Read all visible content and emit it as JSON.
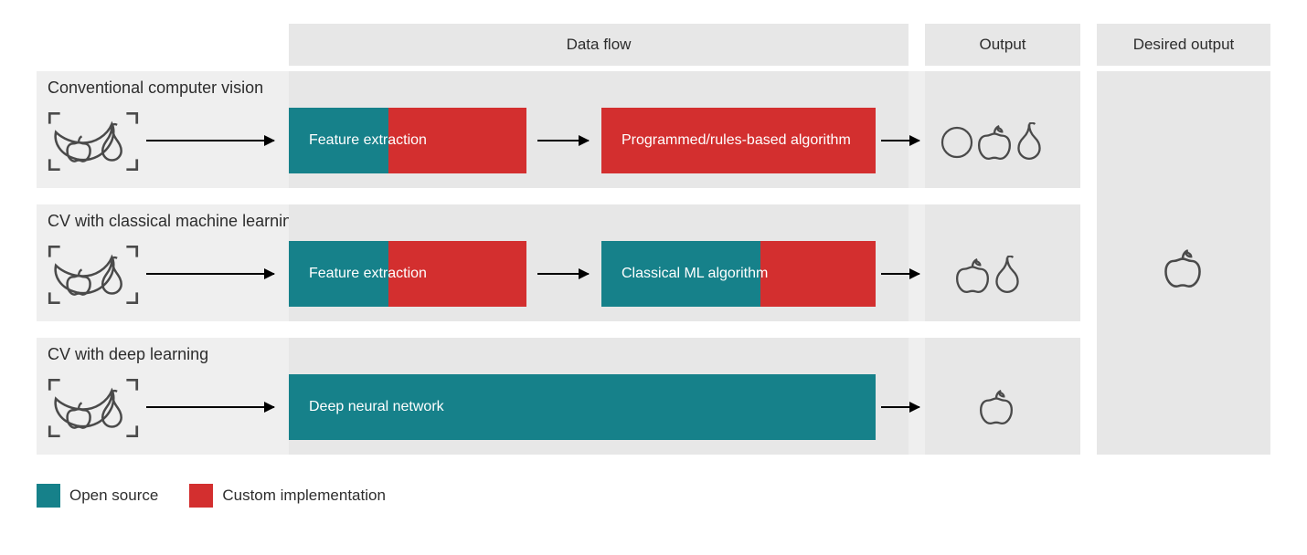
{
  "headers": {
    "data_flow": "Data flow",
    "output": "Output",
    "desired_output": "Desired output"
  },
  "rows": [
    {
      "title": "Conventional computer vision",
      "block1": {
        "label": "Feature extraction",
        "split": "teal-red",
        "teal_frac": 0.42,
        "red_frac": 0.58
      },
      "block2": {
        "label": "Programmed/rules-based algorithm",
        "split": "red-only"
      },
      "output_icons": [
        "circle",
        "apple",
        "pear"
      ]
    },
    {
      "title": "CV with classical machine learning",
      "block1": {
        "label": "Feature extraction",
        "split": "teal-red",
        "teal_frac": 0.42,
        "red_frac": 0.58
      },
      "block2": {
        "label": "Classical ML algorithm",
        "split": "teal-red",
        "teal_frac": 0.58,
        "red_frac": 0.42
      },
      "output_icons": [
        "apple",
        "pear"
      ]
    },
    {
      "title": "CV with deep learning",
      "block_wide": {
        "label": "Deep neural network",
        "split": "teal-only"
      },
      "output_icons": [
        "apple"
      ]
    }
  ],
  "desired_output_icon": "apple",
  "legend": {
    "open_source": "Open source",
    "custom_impl": "Custom implementation"
  },
  "colors": {
    "teal": "#16818a",
    "red": "#d32f2f",
    "gray_light": "#efefef",
    "gray_mid": "#e7e7e7"
  }
}
